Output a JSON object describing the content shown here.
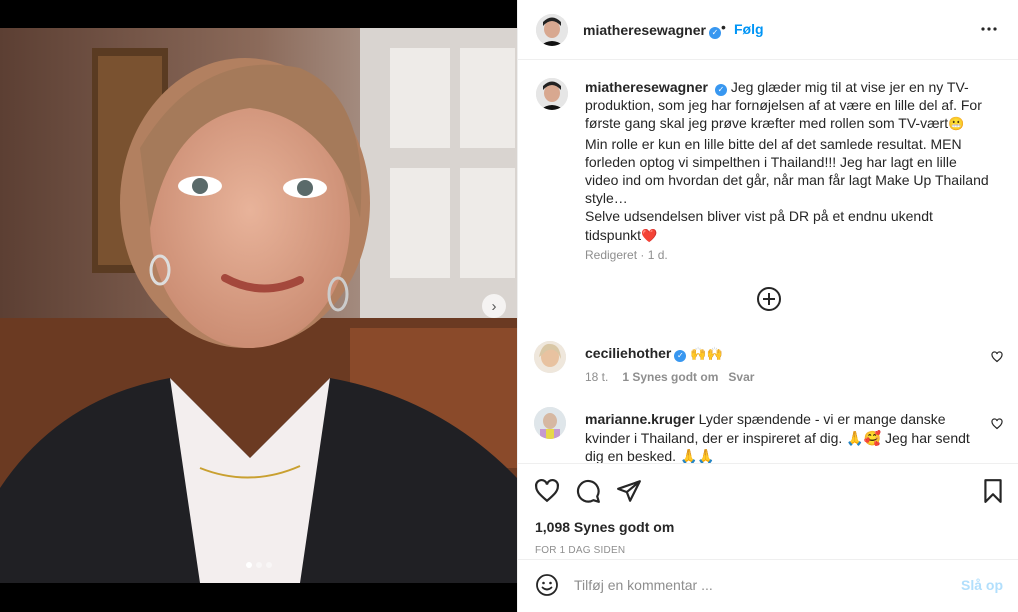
{
  "post": {
    "username": "miatheresewagner",
    "follow_label": "Følg",
    "more_label": "•••",
    "separator": "•",
    "caption_parts": [
      "Jeg glæder mig til at vise jer en ny TV-produktion, som jeg har fornøjelsen af at være en lille del af. For første gang skal jeg prøve kræfter med rollen som TV-vært",
      "😬",
      " Min rolle er kun en lille bitte del af det samlede resultat. MEN forleden optog vi simpelthen i Thailand!!! Jeg har lagt en lille video ind om hvordan det går, når man får lagt Make Up Thailand style…",
      "Selve udsendelsen bliver vist på DR på et endnu ukendt tidspunkt",
      "❤️"
    ],
    "caption_meta": "Redigeret · 1 d.",
    "likes": "1,098 Synes godt om",
    "time_ago": "FOR 1 DAG SIDEN"
  },
  "comments": [
    {
      "username": "ceciliehother",
      "text": "🙌🙌",
      "time": "18 t.",
      "likes": "1 Synes godt om",
      "reply": "Svar"
    },
    {
      "username": "marianne.kruger",
      "text": "Lyder spændende - vi er mange danske kvinder i Thailand, der er inspireret af dig. 🙏🥰 Jeg har sendt dig en besked. 🙏🙏"
    }
  ],
  "comment_box": {
    "placeholder": "Tilføj en kommentar ...",
    "post_label": "Slå op"
  },
  "carousel": {
    "slides": 3,
    "active": 1,
    "next_icon": "chevron-right-icon"
  },
  "colors": {
    "accent": "#0095f6",
    "verified": "#3897f0",
    "muted": "#8e8e8e",
    "post_disabled": "#b2dffc"
  }
}
